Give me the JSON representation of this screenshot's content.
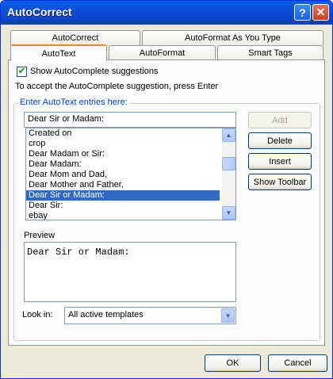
{
  "window": {
    "title": "AutoCorrect",
    "help_glyph": "?",
    "close_glyph": "✕"
  },
  "tabs": {
    "row1": [
      {
        "label": "AutoCorrect"
      },
      {
        "label": "AutoFormat As You Type"
      }
    ],
    "row2": [
      {
        "label": "AutoText",
        "active": true
      },
      {
        "label": "AutoFormat"
      },
      {
        "label": "Smart Tags"
      }
    ]
  },
  "autotext": {
    "show_suggestions_label": "Show AutoComplete suggestions",
    "show_suggestions_checked": true,
    "accept_hint": "To accept the AutoComplete suggestion, press Enter",
    "entries_label": "Enter AutoText entries here:",
    "entry_value": "Dear Sir or Madam:",
    "entries": [
      "Created on",
      "crop",
      "Dear Madam or Sir:",
      "Dear Madam:",
      "Dear Mom and Dad,",
      "Dear Mother and Father,",
      "Dear Sir or Madam:",
      "Dear Sir:",
      "ebay"
    ],
    "selected_entry": "Dear Sir or Madam:",
    "buttons": {
      "add": "Add",
      "delete": "Delete",
      "insert": "Insert",
      "show_toolbar": "Show Toolbar"
    },
    "preview_label": "Preview",
    "preview_text": "Dear Sir or Madam:",
    "look_in_label": "Look in:",
    "look_in_value": "All active templates"
  },
  "footer": {
    "ok": "OK",
    "cancel": "Cancel"
  },
  "colors": {
    "titlebar": "#0a5de8",
    "selection": "#316ac5",
    "tab_highlight": "#e68b2c",
    "group_label": "#0046d5"
  }
}
